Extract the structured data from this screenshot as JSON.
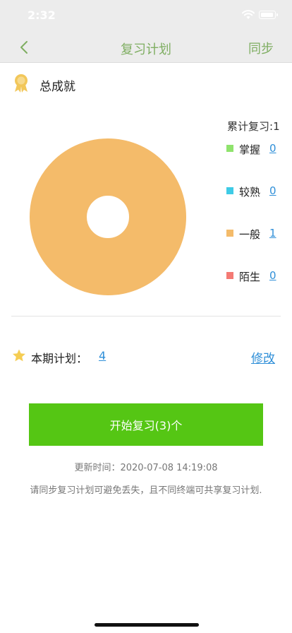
{
  "status_bar": {
    "time": "2:32"
  },
  "nav": {
    "title": "复习计划",
    "sync_label": "同步"
  },
  "achievement": {
    "title": "总成就"
  },
  "chart_data": {
    "type": "pie",
    "categories": [
      "掌握",
      "较熟",
      "一般",
      "陌生"
    ],
    "values": [
      0,
      0,
      1,
      0
    ],
    "colors": [
      "#8fe36d",
      "#3ecbe6",
      "#f4bb6a",
      "#f47a74"
    ]
  },
  "summary": {
    "total_label": "累计复习:",
    "total_value": "1"
  },
  "legend": [
    {
      "label": "掌握",
      "count": "0",
      "color": "#8fe36d"
    },
    {
      "label": "较熟",
      "count": "0",
      "color": "#3ecbe6"
    },
    {
      "label": "一般",
      "count": "1",
      "color": "#f4bb6a"
    },
    {
      "label": "陌生",
      "count": "0",
      "color": "#f47a74"
    }
  ],
  "plan": {
    "label": "本期计划：",
    "value": "4",
    "edit_label": "修改"
  },
  "start_button": {
    "label": "开始复习(3)个"
  },
  "footer": {
    "update_time": "更新时间：2020-07-08 14:19:08",
    "tip": "请同步复习计划可避免丢失，且不同终端可共享复习计划."
  }
}
